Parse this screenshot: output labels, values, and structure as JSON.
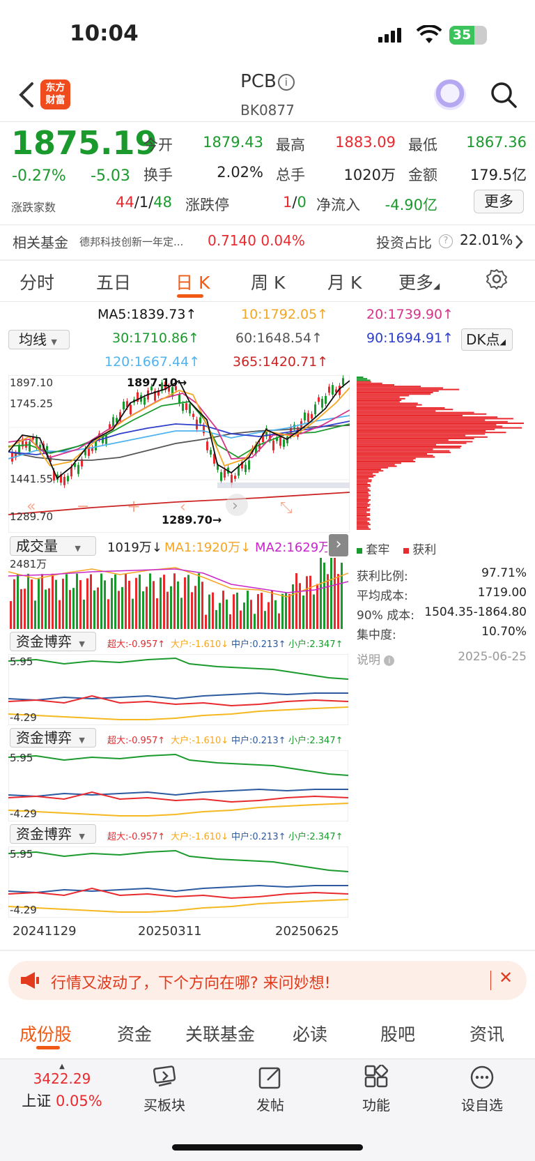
{
  "status": {
    "time": "10:04",
    "battery": "35"
  },
  "header": {
    "logo_line1": "东方",
    "logo_line2": "财富",
    "title": "PCB",
    "code": "BK0877"
  },
  "quote": {
    "price": "1875.19",
    "change_pct": "-0.27%",
    "change_val": "-5.03",
    "updown_label": "涨跌家数",
    "updown_up": "44",
    "updown_flat": "/1/",
    "updown_down": "48",
    "open_label": "今开",
    "open": "1879.43",
    "high_label": "最高",
    "high": "1883.09",
    "low_label": "最低",
    "low": "1867.36",
    "turnover_label": "换手",
    "turnover": "2.02%",
    "volume_label": "总手",
    "volume": "1020万",
    "amount_label": "金额",
    "amount": "179.5亿",
    "limit_label": "涨跌停",
    "limit_up": "1",
    "limit_sep": "/",
    "limit_down": "0",
    "netflow_label": "净流入",
    "netflow": "-4.90亿",
    "more_label": "更多"
  },
  "fund": {
    "label": "相关基金",
    "name": "德邦科技创新一年定...",
    "value": "0.7140 0.04%",
    "invest_label": "投资占比",
    "invest_value": "22.01%"
  },
  "tabs": [
    "分时",
    "五日",
    "日 K",
    "周 K",
    "月 K",
    "更多"
  ],
  "ma": {
    "selector": "均线",
    "ma5": "MA5:1839.73↑",
    "ma10": "10:1792.05↑",
    "ma20": "20:1739.90↑",
    "ma30": "30:1710.86↑",
    "ma60": "60:1648.54↑",
    "ma90": "90:1694.91↑",
    "ma120": "120:1667.44↑",
    "ma365": "365:1420.71↑",
    "dk": "DK点",
    "colors": {
      "ma5": "#111111",
      "ma10": "#f5a623",
      "ma20": "#d6338a",
      "ma30": "#1a9a2c",
      "ma60": "#555555",
      "ma90": "#2c3ecb",
      "ma120": "#4fb3f0",
      "ma365": "#cc2222"
    }
  },
  "kline": {
    "axis_top": "1897.10",
    "axis_2": "1745.25",
    "axis_3": "1441.55",
    "axis_bottom": "1289.70",
    "hi_marker": "1897.10→",
    "lo_marker": "1289.70→"
  },
  "volume": {
    "selector": "成交量",
    "value": "1019万↓",
    "ma1": "MA1:1920万↓",
    "ma2": "MA2:1629万↓",
    "axis_top": "2481万"
  },
  "capital": {
    "selector": "资金博弈",
    "super": "超大:-0.957↑",
    "large": "大户:-1.610↓",
    "mid": "中户:0.213↑",
    "small": "小户:2.347↑",
    "axis_top": "5.95",
    "axis_bottom": "-4.29"
  },
  "dates": [
    "20241129",
    "20250311",
    "20250625"
  ],
  "chip": {
    "legend_trap": "套牢",
    "legend_profit": "获利",
    "profit_ratio_label": "获利比例:",
    "profit_ratio": "97.71%",
    "avg_cost_label": "平均成本:",
    "avg_cost": "1719.00",
    "cost90_label": "90% 成本:",
    "cost90": "1504.35-1864.80",
    "concentration_label": "集中度:",
    "concentration": "10.70%",
    "note_label": "说明",
    "note_date": "2025-06-25"
  },
  "banner": {
    "text": "行情又波动了，下个方向在哪? 来问妙想!"
  },
  "bottom_tabs": [
    "成份股",
    "资金",
    "关联基金",
    "必读",
    "股吧",
    "资讯"
  ],
  "index": {
    "value": "3422.29",
    "name": "上证",
    "pct": "0.05%"
  },
  "bottom_nav": [
    "买板块",
    "发帖",
    "功能",
    "设自选"
  ]
}
